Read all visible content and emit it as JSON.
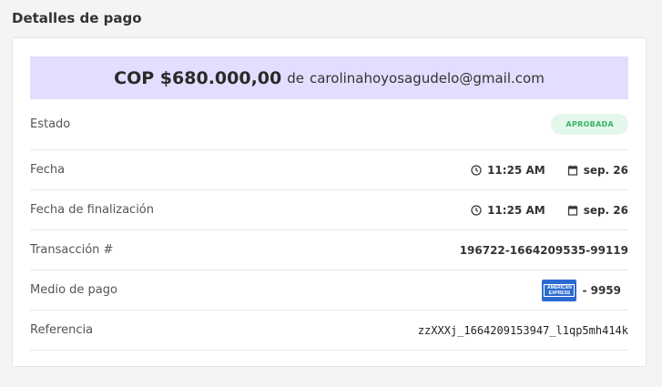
{
  "section": {
    "title": "Detalles de pago"
  },
  "banner": {
    "amount": "COP $680.000,00",
    "de": "de",
    "email": "carolinahoyosagudelo@gmail.com",
    "background": "#e3ddff"
  },
  "rows": {
    "estado": {
      "label": "Estado",
      "badge": "APROBADA",
      "badge_color": "#3bb36a"
    },
    "fecha": {
      "label": "Fecha",
      "time": "11:25 AM",
      "date": "sep. 26"
    },
    "finalizacion": {
      "label": "Fecha de finalización",
      "time": "11:25 AM",
      "date": "sep. 26"
    },
    "transaccion": {
      "label": "Transacción #",
      "value": "196722-1664209535-99119"
    },
    "medio": {
      "label": "Medio de pago",
      "card_brand_line1": "AMERICAN",
      "card_brand_line2": "EXPRESS",
      "last4": "- 9959",
      "card_icon": "amex-card-icon"
    },
    "referencia": {
      "label": "Referencia",
      "value": "zzXXXj_1664209153947_l1qp5mh414k"
    }
  },
  "icons": {
    "clock": "clock-icon",
    "calendar": "calendar-icon"
  }
}
